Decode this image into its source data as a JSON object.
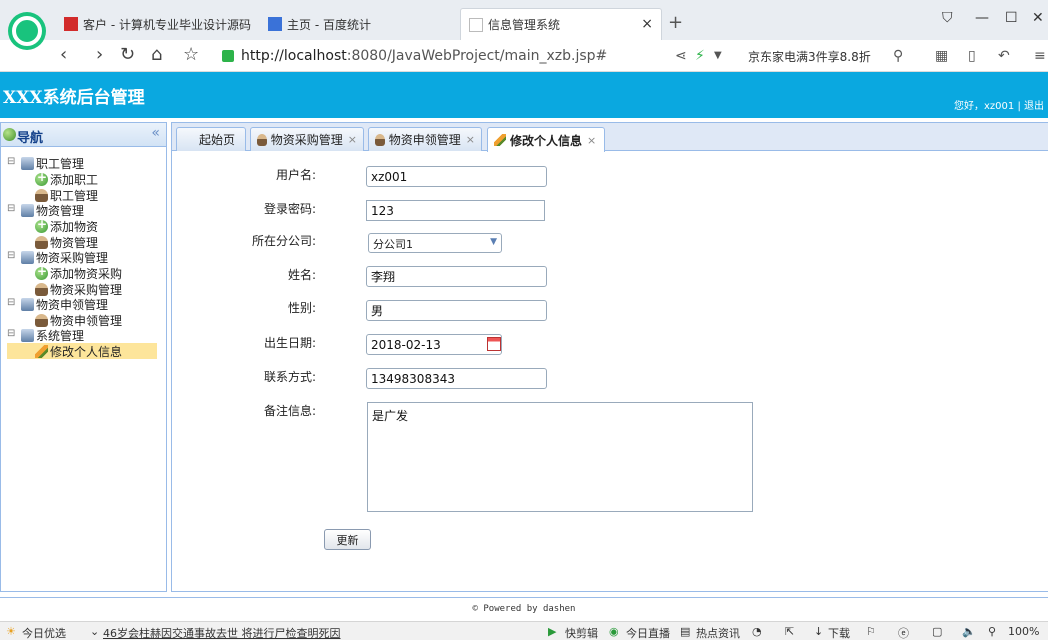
{
  "browser": {
    "tabs": [
      {
        "title": "客户 - 计算机专业毕业设计源码",
        "favicon_color": "#d22b2b"
      },
      {
        "title": "主页 - 百度统计",
        "favicon_color": "#3a72d8"
      },
      {
        "title": "信息管理系统",
        "favicon_color": "#bbbbbb"
      }
    ],
    "tab_close": "×",
    "new_tab": "+",
    "url_host": "http://localhost",
    "url_rest": ":8080/JavaWebProject/main_xzb.jsp#",
    "promo": "京东家电满3件享8.8折"
  },
  "app": {
    "title": "XXX系统后台管理",
    "user_text": "您好，xz001 | 退出"
  },
  "sidebar": {
    "title": "导航",
    "collapse": "«",
    "tree": [
      {
        "label": "职工管理",
        "icon": "folder-icon",
        "level": 0
      },
      {
        "label": "添加职工",
        "icon": "add-icon",
        "level": 1
      },
      {
        "label": "职工管理",
        "icon": "person-icon",
        "level": 1
      },
      {
        "label": "物资管理",
        "icon": "folder-icon",
        "level": 0
      },
      {
        "label": "添加物资",
        "icon": "add-icon",
        "level": 1
      },
      {
        "label": "物资管理",
        "icon": "person-icon",
        "level": 1
      },
      {
        "label": "物资采购管理",
        "icon": "folder-icon",
        "level": 0
      },
      {
        "label": "添加物资采购",
        "icon": "add-icon",
        "level": 1
      },
      {
        "label": "物资采购管理",
        "icon": "person-icon",
        "level": 1
      },
      {
        "label": "物资申领管理",
        "icon": "folder-icon",
        "level": 0
      },
      {
        "label": "物资申领管理",
        "icon": "person-icon",
        "level": 1
      },
      {
        "label": "系统管理",
        "icon": "folder-icon",
        "level": 0
      },
      {
        "label": "修改个人信息",
        "icon": "pencil-icon",
        "level": 1,
        "selected": true
      }
    ]
  },
  "content_tabs": [
    {
      "label": "起始页",
      "closable": false
    },
    {
      "label": "物资采购管理",
      "closable": true
    },
    {
      "label": "物资申领管理",
      "closable": true
    },
    {
      "label": "修改个人信息",
      "closable": true,
      "active": true
    }
  ],
  "form": {
    "username_label": "用户名:",
    "username_value": "xz001",
    "password_label": "登录密码:",
    "password_value": "123",
    "branch_label": "所在分公司:",
    "branch_value": "分公司1",
    "name_label": "姓名:",
    "name_value": "李翔",
    "gender_label": "性别:",
    "gender_value": "男",
    "birth_label": "出生日期:",
    "birth_value": "2018-02-13",
    "phone_label": "联系方式:",
    "phone_value": "13498308343",
    "notes_label": "备注信息:",
    "notes_value": "是广发",
    "submit_label": "更新"
  },
  "footer": "© Powered by dashen",
  "statusbar": {
    "left": "今日优选",
    "news": "46岁会柱赫因交通事故去世 将进行尸检查明死因",
    "clip": "快剪辑",
    "live": "今日直播",
    "hot": "热点资讯",
    "download": "下载",
    "zoom": "100%"
  },
  "colors": {
    "header": "#0aa8e0",
    "panel_border": "#99bbe8",
    "selected_item": "#fde59b"
  }
}
